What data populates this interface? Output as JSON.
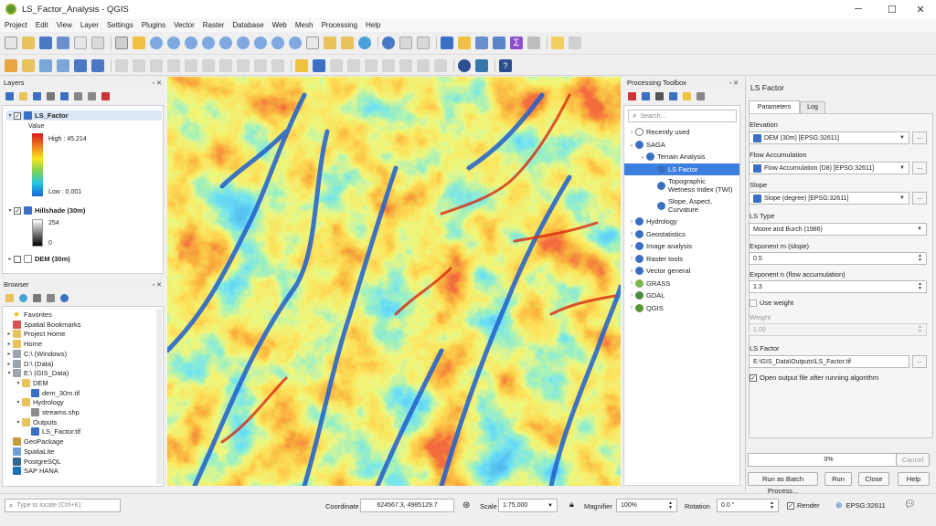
{
  "window": {
    "title": "LS_Factor_Analysis - QGIS",
    "minimize": "─",
    "maximize": "☐",
    "close": "✕"
  },
  "menu": [
    "Project",
    "Edit",
    "View",
    "Layer",
    "Settings",
    "Plugins",
    "Vector",
    "Raster",
    "Database",
    "Web",
    "Mesh",
    "Processing",
    "Help"
  ],
  "layers_panel": {
    "title": "Layers",
    "layers": [
      {
        "name": "LS_Factor",
        "checked": true,
        "legend_title": "Value",
        "high": "High : 45.214",
        "low": "Low : 0.001"
      },
      {
        "name": "Hillshade (30m)",
        "checked": true,
        "high": "254",
        "low": "0"
      },
      {
        "name": "DEM (30m)",
        "checked": false
      }
    ]
  },
  "browser_panel": {
    "title": "Browser",
    "items": [
      {
        "label": "Favorites",
        "indent": 0,
        "icon": "star-icon"
      },
      {
        "label": "Spatial Bookmarks",
        "indent": 0,
        "icon": "bookmark-icon"
      },
      {
        "label": "Project Home",
        "indent": 0,
        "icon": "folder-icon"
      },
      {
        "label": "Home",
        "indent": 0,
        "icon": "folder-icon"
      },
      {
        "label": "C:\\ (Windows)",
        "indent": 0,
        "icon": "drive-icon"
      },
      {
        "label": "D:\\ (Data)",
        "indent": 0,
        "icon": "drive-icon"
      },
      {
        "label": "E:\\ (GIS_Data)",
        "indent": 0,
        "icon": "drive-icon"
      },
      {
        "label": "DEM",
        "indent": 1,
        "icon": "folder-icon"
      },
      {
        "label": "dem_30m.tif",
        "indent": 2,
        "icon": "raster-icon"
      },
      {
        "label": "Hydrology",
        "indent": 1,
        "icon": "folder-icon"
      },
      {
        "label": "streams.shp",
        "indent": 2,
        "icon": "line-layer-icon"
      },
      {
        "label": "Outputs",
        "indent": 1,
        "icon": "folder-icon"
      },
      {
        "label": "LS_Factor.tif",
        "indent": 2,
        "icon": "raster-icon"
      },
      {
        "label": "GeoPackage",
        "indent": 0,
        "icon": "geopackage-icon"
      },
      {
        "label": "SpatiaLite",
        "indent": 0,
        "icon": "spatialite-icon"
      },
      {
        "label": "PostgreSQL",
        "indent": 0,
        "icon": "postgresql-icon"
      },
      {
        "label": "SAP HANA",
        "indent": 0,
        "icon": "sap-hana-icon"
      }
    ]
  },
  "toolbox": {
    "title": "Processing Toolbox",
    "search_placeholder": "Search...",
    "items": [
      {
        "label": "Recently used",
        "indent": 0,
        "arrow": "›"
      },
      {
        "label": "SAGA",
        "indent": 0,
        "arrow": "⌄"
      },
      {
        "label": "Terrain Analysis",
        "indent": 1,
        "arrow": "⌄"
      },
      {
        "label": "LS Factor",
        "indent": 2,
        "arrow": "",
        "selected": true
      },
      {
        "label": "Topographic\nWetness Index (TWI)",
        "indent": 2,
        "arrow": ""
      },
      {
        "label": "Slope, Aspect,\nCurvature",
        "indent": 2,
        "arrow": ""
      },
      {
        "label": "Hydrology",
        "indent": 0,
        "arrow": "›"
      },
      {
        "label": "Geostatistics",
        "indent": 0,
        "arrow": "›"
      },
      {
        "label": "Image analysis",
        "indent": 0,
        "arrow": "›"
      },
      {
        "label": "Raster tools",
        "indent": 0,
        "arrow": "›"
      },
      {
        "label": "Vector general",
        "indent": 0,
        "arrow": "›"
      },
      {
        "label": "GRASS",
        "indent": 0,
        "arrow": "›"
      },
      {
        "label": "GDAL",
        "indent": 0,
        "arrow": "›"
      },
      {
        "label": "QGIS",
        "indent": 0,
        "arrow": "›"
      }
    ]
  },
  "algorithm": {
    "title": "LS Factor",
    "tabs": [
      "Parameters",
      "Log"
    ],
    "elevation_label": "Elevation",
    "elevation_value": "DEM (30m) [EPSG:32611]",
    "flow_label": "Flow Accumulation",
    "flow_value": "Flow Accumulation (D8) [EPSG:32611]",
    "slope_label": "Slope",
    "slope_value": "Slope (degree) [EPSG:32611]",
    "lstype_label": "LS Type",
    "lstype_value": "Moore and Burch (1986)",
    "exp_m_label": "Exponent m (slope)",
    "exp_m_value": "0.5",
    "exp_n_label": "Exponent n (flow accumulation)",
    "exp_n_value": "1.3",
    "use_weight_label": "Use weight",
    "weight_label": "Weight",
    "weight_value": "1.00",
    "output_label": "LS Factor",
    "output_value": "E:\\GIS_Data\\Outputs\\LS_Factor.tif",
    "open_output_label": "Open output file after running algorithm",
    "ellipsis": "...",
    "progress": "0%",
    "progress_fraction": 0,
    "cancel": "Cancel",
    "batch": "Run as Batch Process...",
    "run": "Run",
    "close": "Close",
    "help": "Help"
  },
  "status": {
    "locate_placeholder": "Type to locate (Ctrl+K)",
    "coordinate_label": "Coordinate",
    "coordinate_value": "624567.3, 4985129.7",
    "scale_label": "Scale",
    "scale_value": "1:75,000",
    "magnifier_label": "Magnifier",
    "magnifier_value": "100%",
    "rotation_label": "Rotation",
    "rotation_value": "0.0 °",
    "render_label": "Render",
    "crs": "EPSG:32611"
  },
  "colors": {
    "accent": "#3874d6",
    "selected": "#3d7fde",
    "qgis_green": "#589632"
  }
}
